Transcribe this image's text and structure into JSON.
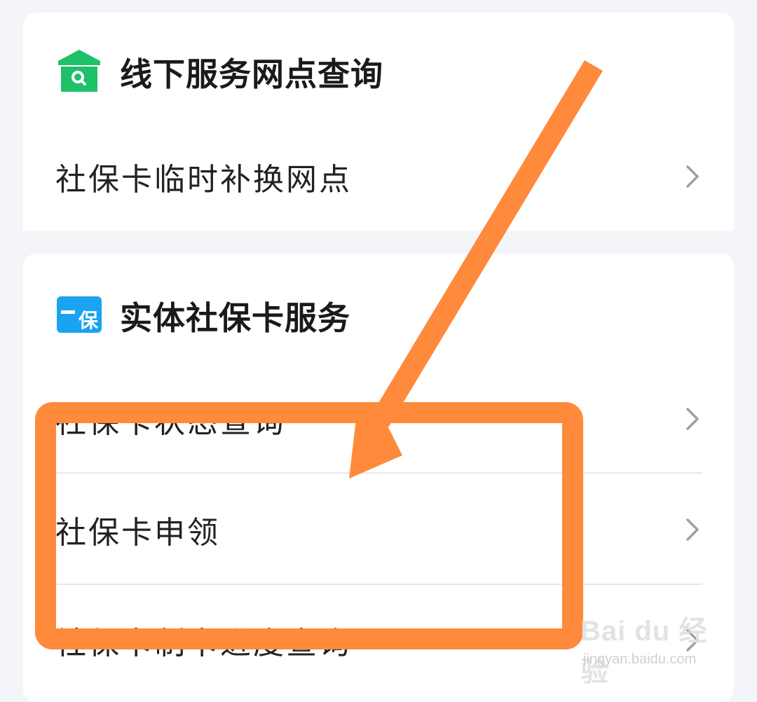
{
  "section_offline": {
    "title": "线下服务网点查询",
    "icon": "service-point-search-icon",
    "items": [
      {
        "label": "社保卡临时补换网点"
      }
    ]
  },
  "section_card": {
    "title": "实体社保卡服务",
    "icon": "social-security-card-icon",
    "icon_text": "保",
    "items": [
      {
        "label": "社保卡状态查询"
      },
      {
        "label": "社保卡申领"
      },
      {
        "label": "社保卡制卡进度查询"
      }
    ]
  },
  "annotation": {
    "color": "#ff8a3b"
  },
  "watermark": {
    "brand": "Bai du 经验",
    "url": "jingyan.baidu.com"
  },
  "colors": {
    "icon_green": "#1ec06a",
    "icon_blue": "#1aa3f0",
    "chevron": "#9aa0a6"
  }
}
